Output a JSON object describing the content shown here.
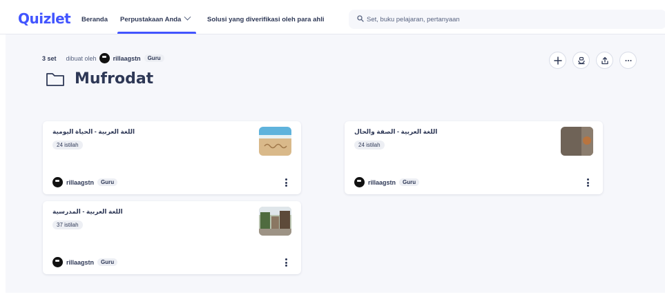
{
  "header": {
    "logo": "Quizlet",
    "nav": {
      "home": "Beranda",
      "library": "Perpustakaan Anda",
      "expert": "Solusi yang diverifikasi oleh para ahli"
    },
    "search_placeholder": "Set, buku pelajaran, pertanyaan"
  },
  "folder": {
    "set_count": "3 set",
    "created_by": "dibuat oleh",
    "username": "rillaagstn",
    "role": "Guru",
    "title": "Mufrodat"
  },
  "sets": [
    {
      "title": "اللغة العربية - الحياة اليومية",
      "terms": "24 istilah",
      "username": "rillaagstn",
      "role": "Guru"
    },
    {
      "title": "اللغة العربية - الصفة والحال",
      "terms": "24 istilah",
      "username": "rillaagstn",
      "role": "Guru"
    },
    {
      "title": "اللغة العربية - المدرسية",
      "terms": "37 istilah",
      "username": "rillaagstn",
      "role": "Guru"
    }
  ],
  "icons": {
    "add": "plus-icon",
    "study": "study-icon",
    "share": "share-icon",
    "more": "more-horizontal-icon",
    "folder": "folder-icon",
    "search": "search-icon",
    "card_more": "more-vertical-icon"
  },
  "colors": {
    "brand": "#4255ff",
    "text": "#2e3856",
    "background": "#f6f7fb"
  }
}
